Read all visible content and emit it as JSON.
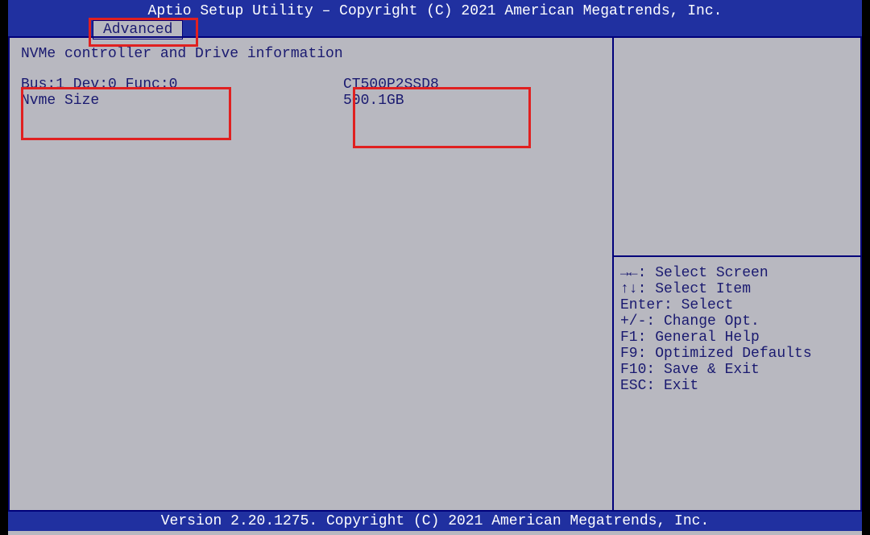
{
  "header": {
    "title": "Aptio Setup Utility – Copyright (C) 2021 American Megatrends, Inc.",
    "tab": "Advanced"
  },
  "main": {
    "section_title": "NVMe controller and Drive information",
    "rows": [
      {
        "label": "Bus:1 Dev:0 Func:0",
        "value": "CT500P2SSD8"
      },
      {
        "label": "Nvme Size",
        "value": "500.1GB"
      }
    ]
  },
  "help": [
    "→←: Select Screen",
    "↑↓: Select Item",
    "Enter: Select",
    "+/-: Change Opt.",
    "F1: General Help",
    "F9: Optimized Defaults",
    "F10: Save & Exit",
    "ESC: Exit"
  ],
  "footer": "Version 2.20.1275. Copyright (C) 2021 American Megatrends, Inc."
}
